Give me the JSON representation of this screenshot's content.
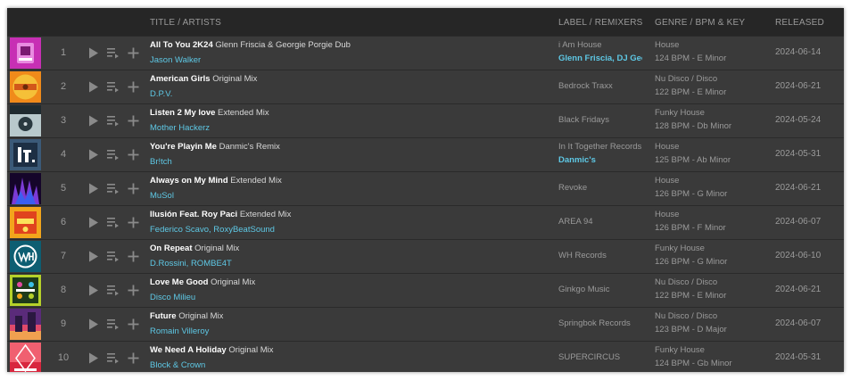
{
  "header": {
    "title_artists": "TITLE / ARTISTS",
    "label_remixers": "LABEL / REMIXERS",
    "genre_bpm_key": "GENRE / BPM & KEY",
    "released": "RELEASED"
  },
  "colors": {
    "panel": "#333333",
    "row": "#3a3a3a",
    "header": "#262626",
    "accent_link": "#5ec8e5",
    "muted_text": "#9a9a9a"
  },
  "icons": {
    "play": "play-icon",
    "queue": "add-to-queue-icon",
    "add": "add-to-playlist-icon"
  },
  "tracks": [
    {
      "num": "1",
      "title": "All To You 2K24",
      "mix": "Glenn Friscia & Georgie Porgie Dub",
      "artists": [
        "Jason Walker"
      ],
      "label": "i Am House",
      "remixers": "Glenn Friscia, DJ Georgie Porgie",
      "genre": "House",
      "bpm_key": "124 BPM - E Minor",
      "released": "2024-06-14"
    },
    {
      "num": "2",
      "title": "American Girls",
      "mix": "Original Mix",
      "artists": [
        "D.P.V."
      ],
      "label": "Bedrock Traxx",
      "remixers": "",
      "genre": "Nu Disco / Disco",
      "bpm_key": "122 BPM - E Minor",
      "released": "2024-06-21"
    },
    {
      "num": "3",
      "title": "Listen 2 My love",
      "mix": "Extended Mix",
      "artists": [
        "Mother Hackerz"
      ],
      "label": "Black Fridays",
      "remixers": "",
      "genre": "Funky House",
      "bpm_key": "128 BPM - Db Minor",
      "released": "2024-05-24"
    },
    {
      "num": "4",
      "title": "You're Playin Me",
      "mix": "Danmic's Remix",
      "artists": [
        "Br!tch"
      ],
      "label": "In It Together Records",
      "remixers": "Danmic's",
      "genre": "House",
      "bpm_key": "125 BPM - Ab Minor",
      "released": "2024-05-31"
    },
    {
      "num": "5",
      "title": "Always on My Mind",
      "mix": "Extended Mix",
      "artists": [
        "MuSol"
      ],
      "label": "Revoke",
      "remixers": "",
      "genre": "House",
      "bpm_key": "126 BPM - G Minor",
      "released": "2024-06-21"
    },
    {
      "num": "6",
      "title": "Ilusión Feat. Roy Paci",
      "mix": "Extended Mix",
      "artists": [
        "Federico Scavo",
        "RoxyBeatSound"
      ],
      "label": "AREA 94",
      "remixers": "",
      "genre": "House",
      "bpm_key": "126 BPM - F Minor",
      "released": "2024-06-07"
    },
    {
      "num": "7",
      "title": "On Repeat",
      "mix": "Original Mix",
      "artists": [
        "D.Rossini",
        "ROMBE4T"
      ],
      "label": "WH Records",
      "remixers": "",
      "genre": "Funky House",
      "bpm_key": "126 BPM - G Minor",
      "released": "2024-06-10"
    },
    {
      "num": "8",
      "title": "Love Me Good",
      "mix": "Original Mix",
      "artists": [
        "Disco Milieu"
      ],
      "label": "Ginkgo Music",
      "remixers": "",
      "genre": "Nu Disco / Disco",
      "bpm_key": "122 BPM - E Minor",
      "released": "2024-06-21"
    },
    {
      "num": "9",
      "title": "Future",
      "mix": "Original Mix",
      "artists": [
        "Romain Villeroy"
      ],
      "label": "Springbok Records",
      "remixers": "",
      "genre": "Nu Disco / Disco",
      "bpm_key": "123 BPM - D Major",
      "released": "2024-06-07"
    },
    {
      "num": "10",
      "title": "We Need A Holiday",
      "mix": "Original Mix",
      "artists": [
        "Block & Crown"
      ],
      "label": "SUPERCIRCUS",
      "remixers": "",
      "genre": "Funky House",
      "bpm_key": "124 BPM - Gb Minor",
      "released": "2024-05-31"
    }
  ]
}
